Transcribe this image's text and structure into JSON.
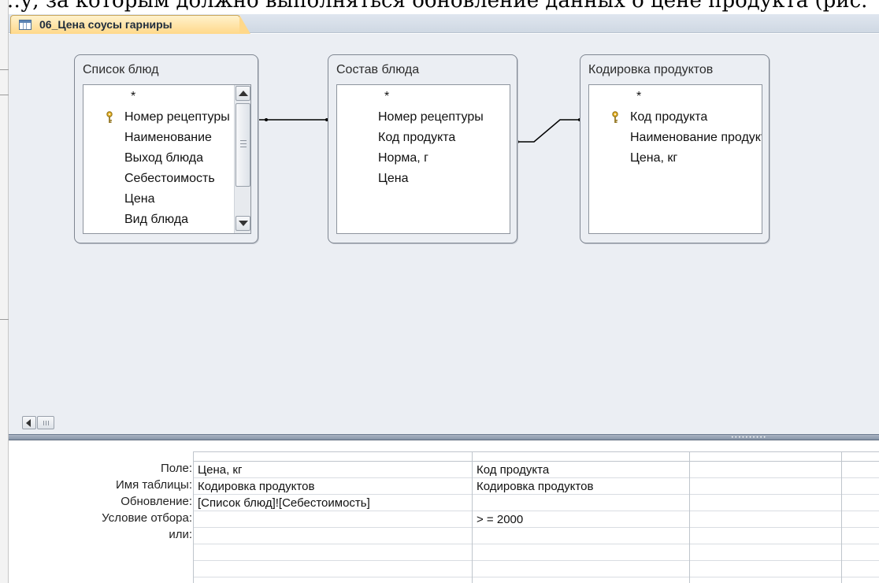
{
  "page_fragment_text": "…у, за которым должно выполняться обновление данных о цене продукта (рис.",
  "document_tab": {
    "title": "06_Цена соусы гарниры",
    "icon": "query-icon"
  },
  "tables": [
    {
      "title": "Список блюд",
      "fields": [
        "*",
        "Номер рецептуры",
        "Наименование",
        "Выход блюда",
        "Себестоимость",
        "Цена",
        "Вид блюда"
      ],
      "key_field_index": 1,
      "has_scrollbar": true
    },
    {
      "title": "Состав блюда",
      "fields": [
        "*",
        "Номер рецептуры",
        "Код продукта",
        "Норма, г",
        "Цена"
      ],
      "key_field_index": null,
      "has_scrollbar": false
    },
    {
      "title": "Кодировка продуктов",
      "fields": [
        "*",
        "Код продукта",
        "Наименование продукта",
        "Цена, кг"
      ],
      "key_field_index": 1,
      "has_scrollbar": false
    }
  ],
  "qbe": {
    "row_labels": [
      "Поле:",
      "Имя таблицы:",
      "Обновление:",
      "Условие отбора:",
      "или:"
    ],
    "columns": [
      {
        "field": "Цена, кг",
        "table": "Кодировка продуктов",
        "update": "[Список блюд]![Себестоимость]",
        "criteria": "",
        "or": ""
      },
      {
        "field": "Код продукта",
        "table": "Кодировка продуктов",
        "update": "",
        "criteria": "> = 2000",
        "or": ""
      },
      {
        "field": "",
        "table": "",
        "update": "",
        "criteria": "",
        "or": ""
      },
      {
        "field": "",
        "table": "",
        "update": "",
        "criteria": "",
        "or": ""
      }
    ]
  },
  "colors": {
    "tab_active": "#ffd88a",
    "design_background": "#ebeef3",
    "splitter": "#8795a8"
  }
}
